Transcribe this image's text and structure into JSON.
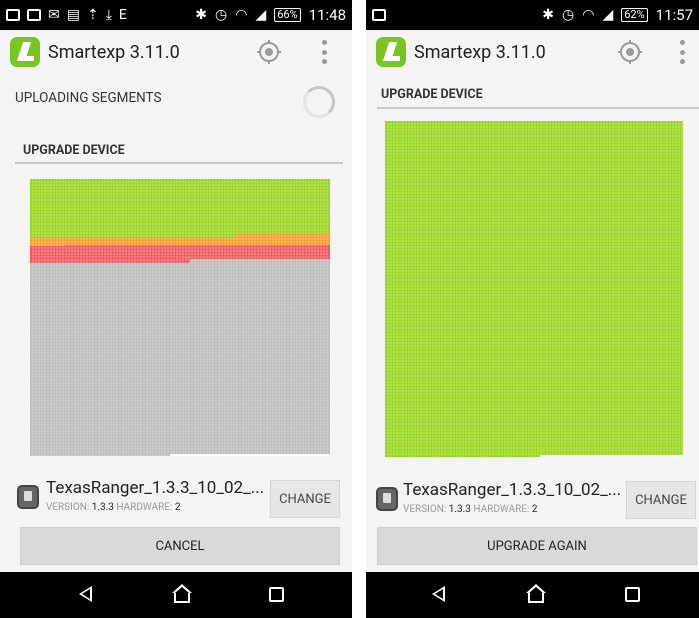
{
  "colors": {
    "accent_green": "#7cc421",
    "grid_complete": "#93d210",
    "grid_active_orange": "#f6971f",
    "grid_active_red": "#ee4c55",
    "grid_pending": "#b8b8b8"
  },
  "left": {
    "status_bar": {
      "left_icons": [
        "notification-icon",
        "gallery-icon",
        "email-icon",
        "document-icon",
        "upload-icon",
        "download-icon",
        "e-icon"
      ],
      "right_icons": [
        "bluetooth-icon",
        "alarm-icon",
        "wifi-icon",
        "signal-icon"
      ],
      "battery": "66%",
      "time": "11:48"
    },
    "app_bar": {
      "title": "Smartexp 3.11.0"
    },
    "upload_status": "UPLOADING SEGMENTS",
    "section_title": "UPGRADE DEVICE",
    "grid": {
      "complete_fraction": 0.21,
      "orange_fraction": 0.03,
      "red_fraction": 0.05
    },
    "file": {
      "name": "TexasRanger_1.3.3_10_02_...",
      "version_label": "VERSION:",
      "version": "1.3.3",
      "hardware_label": "HARDWARE:",
      "hardware": "2"
    },
    "change_label": "CHANGE",
    "action_label": "CANCEL"
  },
  "right": {
    "status_bar": {
      "left_icons": [
        "gallery-icon"
      ],
      "right_icons": [
        "bluetooth-icon",
        "alarm-icon",
        "wifi-icon",
        "signal-icon"
      ],
      "battery": "62%",
      "time": "11:57"
    },
    "app_bar": {
      "title": "Smartexp 3.11.0"
    },
    "section_title": "UPGRADE DEVICE",
    "grid": {
      "complete_fraction": 1.0
    },
    "file": {
      "name": "TexasRanger_1.3.3_10_02_...",
      "version_label": "VERSION:",
      "version": "1.3.3",
      "hardware_label": "HARDWARE:",
      "hardware": "2"
    },
    "change_label": "CHANGE",
    "action_label": "UPGRADE AGAIN"
  }
}
